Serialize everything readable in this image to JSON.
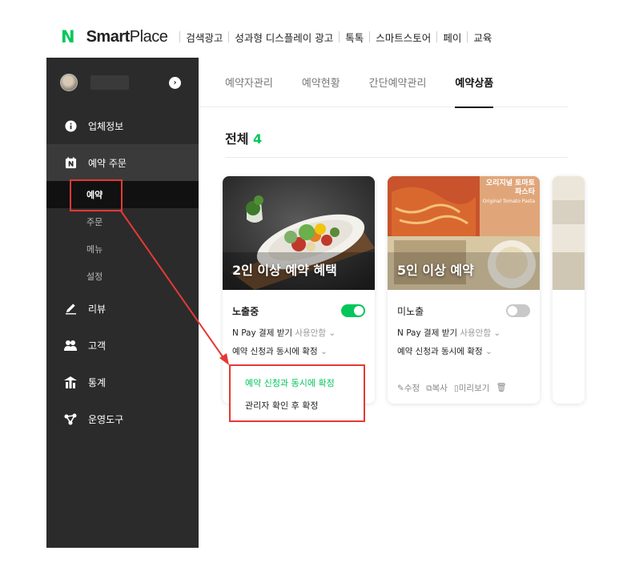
{
  "topbar": {
    "logo_mark": "N",
    "logo_text_bold": "Smart",
    "logo_text_light": "Place",
    "nav": [
      "검색광고",
      "성과형 디스플레이 광고",
      "톡톡",
      "스마트스토어",
      "페이",
      "교육"
    ]
  },
  "sidebar": {
    "items": [
      {
        "icon": "info-icon",
        "label": "업체정보"
      },
      {
        "icon": "naver-booking-icon",
        "label": "예약 주문"
      },
      {
        "icon": "pencil-icon",
        "label": "리뷰"
      },
      {
        "icon": "users-icon",
        "label": "고객"
      },
      {
        "icon": "stats-icon",
        "label": "통계"
      },
      {
        "icon": "tools-icon",
        "label": "운영도구"
      }
    ],
    "sub_items": [
      "예약",
      "주문",
      "메뉴",
      "설정"
    ]
  },
  "tabs": [
    "예약자관리",
    "예약현황",
    "간단예약관리",
    "예약상품"
  ],
  "total": {
    "label": "전체",
    "count": "4"
  },
  "cards": [
    {
      "image_title": "2인 이상 예약 혜택",
      "status": "노출중",
      "toggle_on": true,
      "npay_label": "N Pay 결제 받기",
      "npay_value": "사용안함",
      "confirm_label": "예약 신청과 동시에 확정"
    },
    {
      "image_title": "5인 이상 예약",
      "image_banner": "오리지널 토마토 파스타",
      "image_banner_sub": "Original Tomato Pasta",
      "status": "미노출",
      "toggle_on": false,
      "npay_label": "N Pay 결제 받기",
      "npay_value": "사용안함",
      "confirm_label": "예약 신청과 동시에 확정",
      "actions": [
        "수정",
        "복사",
        "미리보기"
      ]
    }
  ],
  "dropdown": {
    "options": [
      "예약 신청과 동시에 확정",
      "관리자 확인 후 확정"
    ]
  },
  "colors": {
    "accent": "#03c75a",
    "annotation": "#e53935",
    "sidebar": "#2b2b2b"
  }
}
